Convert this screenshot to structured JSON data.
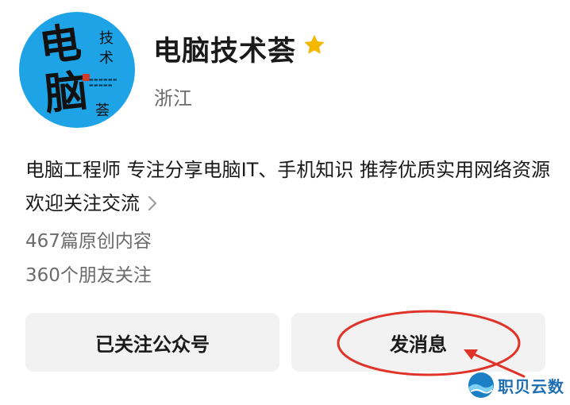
{
  "profile": {
    "name": "电脑技术荟",
    "region": "浙江",
    "description": "电脑工程师 专注分享电脑IT、手机知识 推荐优质实用网络资源 欢迎关注交流",
    "articles": "467篇原创内容",
    "followers": "360个朋友关注",
    "starred_icon": "star-icon",
    "accent_star": "#f5b800"
  },
  "avatar": {
    "char_big_1": "电",
    "char_big_2": "脑",
    "char_small_1": "技",
    "char_small_2": "术",
    "char_small_3": "荟",
    "bg_color": "#1ea4e6"
  },
  "actions": {
    "follow_label": "已关注公众号",
    "message_label": "发消息"
  },
  "annotation": {
    "color": "#e0342a"
  },
  "watermark": {
    "text": "职贝云数",
    "color": "#1e6fb3"
  }
}
